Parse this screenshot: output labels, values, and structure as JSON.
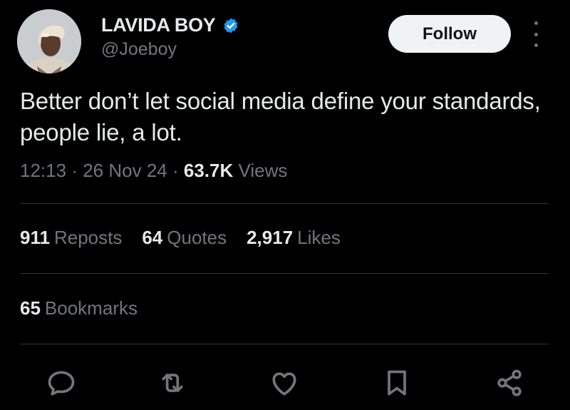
{
  "author": {
    "display_name": "LAVIDA BOY",
    "handle": "@Joeboy",
    "verified": true
  },
  "follow_button": {
    "label": "Follow"
  },
  "tweet": {
    "text": "Better don’t let social media define your standards, people lie, a lot.",
    "time": "12:13",
    "separator": "·",
    "date": "26 Nov 24",
    "views_count": "63.7K",
    "views_label": "Views"
  },
  "stats": {
    "reposts": {
      "count": "911",
      "label": "Reposts"
    },
    "quotes": {
      "count": "64",
      "label": "Quotes"
    },
    "likes": {
      "count": "2,917",
      "label": "Likes"
    },
    "bookmarks": {
      "count": "65",
      "label": "Bookmarks"
    }
  },
  "actions": [
    "reply-icon",
    "repost-icon",
    "like-icon",
    "bookmark-icon",
    "share-icon"
  ],
  "colors": {
    "background": "#000000",
    "primary_text": "#e7e9ea",
    "secondary_text": "#71767b",
    "verified_badge": "#1d9bf0",
    "follow_button_bg": "#eff3f4",
    "divider": "#2f3336"
  }
}
